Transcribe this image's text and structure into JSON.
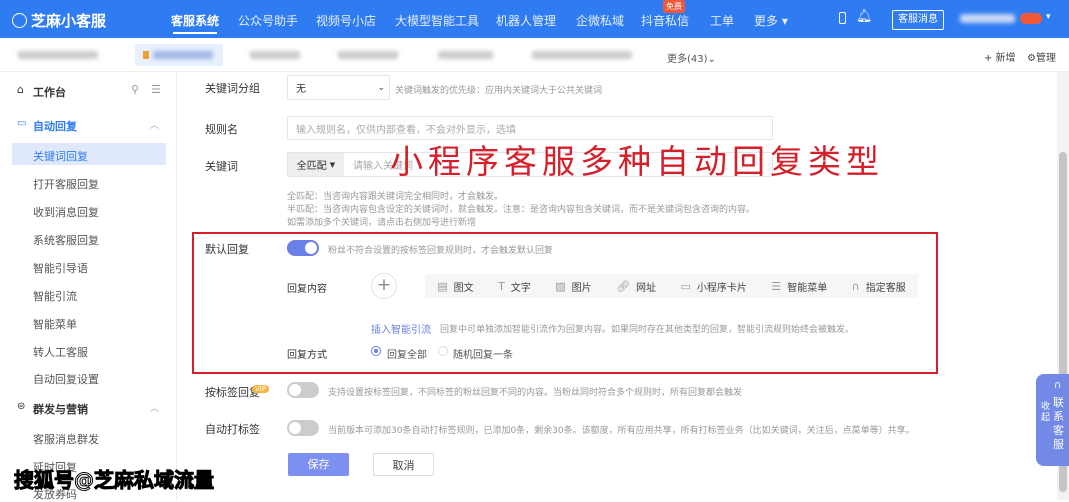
{
  "header": {
    "logo": "芝麻小客服",
    "nav": [
      "客服系统",
      "公众号助手",
      "视频号小店",
      "大模型智能工具",
      "机器人管理",
      "企微私域",
      "抖音私信",
      "工单",
      "更多"
    ],
    "free_badge": "免费",
    "service_msg": "客服消息"
  },
  "tabs": {
    "more": "更多(43)",
    "add": "+ 新增",
    "manage": "管理"
  },
  "sidebar": {
    "workbench": "工作台",
    "group1": "自动回复",
    "items1": [
      "关键词回复",
      "打开客服回复",
      "收到消息回复",
      "系统客服回复",
      "智能引导语",
      "智能引流",
      "智能菜单",
      "转人工客服",
      "自动回复设置"
    ],
    "group2": "群发与营销",
    "items2": [
      "客服消息群发",
      "延时回复",
      "发放券码"
    ]
  },
  "form": {
    "group_label": "关键词分组",
    "group_value": "无",
    "group_hint": "关键词触发的优先级：应用内关键词大于公共关键词",
    "rule_label": "规则名",
    "rule_placeholder": "输入规则名，仅供内部查看，不会对外显示，选填",
    "kw_label": "关键词",
    "kw_match": "全匹配",
    "kw_placeholder": "请输入关键词",
    "kw_hints": [
      "全匹配：当咨询内容跟关键词完全相同时，才会触发。",
      "半匹配：当咨询内容包含设定的关键词时，就会触发。注意：是咨询内容包含关键词，而不是关键词包含咨询的内容。",
      "如需添加多个关键词，请点击右侧加号进行新增"
    ],
    "default_label": "默认回复",
    "default_hint": "粉丝不符合设置的按标签回复规则时，才会触发默认回复",
    "content_label": "回复内容",
    "content_types": [
      "图文",
      "文字",
      "图片",
      "网址",
      "小程序卡片",
      "智能菜单",
      "指定客服"
    ],
    "insert_link": "插入智能引流",
    "insert_hint": "回复中可单独添加智能引流作为回复内容。如果同时存在其他类型的回复，智能引流规则始终会被触发。",
    "mode_label": "回复方式",
    "mode_all": "回复全部",
    "mode_random": "随机回复一条",
    "tag_label": "按标签回复",
    "tag_badge": "VIP",
    "tag_hint": "支持设置按标签回复，不同标签的粉丝回复不同的内容。当粉丝同时符合多个规则时，所有回复都会触发",
    "autotag_label": "自动打标签",
    "autotag_hint": "当前版本可添加30条自动打标签规则，已添加0条，剩余30条。该额度，所有应用共享，所有打标签业务（比如关键词，关注后，点菜单等）共享。",
    "save": "保存",
    "cancel": "取消"
  },
  "overlay": "小程序客服多种自动回复类型",
  "watermark": "搜狐号@芝麻私域流量",
  "float": {
    "collapse": "收起",
    "contact": "联系客服"
  },
  "colors": {
    "brand": "#2f7cf2",
    "accent": "#6b80e8",
    "highlight": "#d4202a"
  }
}
